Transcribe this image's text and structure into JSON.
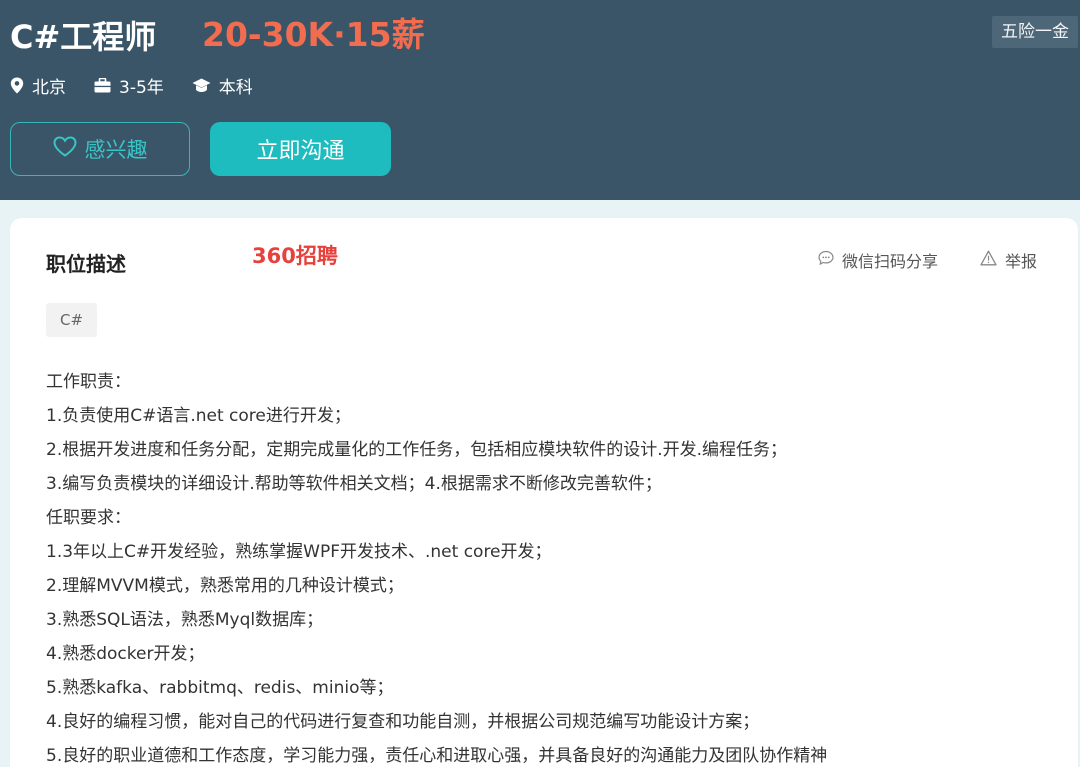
{
  "header": {
    "title": "C#工程师",
    "salary": "20-30K·15薪",
    "benefit": "五险一金",
    "meta": {
      "location": "北京",
      "experience": "3-5年",
      "education": "本科"
    },
    "follow_label": "感兴趣",
    "chat_label": "立即沟通"
  },
  "card": {
    "section_title": "职位描述",
    "watermark": "360招聘",
    "share_label": "微信扫码分享",
    "report_label": "举报",
    "skill_tags": [
      "C#"
    ],
    "description_lines": [
      "工作职责：",
      "1.负责使用C#语言.net core进行开发；",
      "2.根据开发进度和任务分配，定期完成量化的工作任务，包括相应模块软件的设计.开发.编程任务；",
      "3.编写负责模块的详细设计.帮助等软件相关文档；4.根据需求不断修改完善软件；",
      "任职要求：",
      "1.3年以上C#开发经验，熟练掌握WPF开发技术、.net core开发；",
      "2.理解MVVM模式，熟悉常用的几种设计模式；",
      "3.熟悉SQL语法，熟悉Myql数据库；",
      "4.熟悉docker开发；",
      "5.熟悉kafka、rabbitmq、redis、minio等；",
      "4.良好的编程习惯，能对自己的代码进行复查和功能自测，并根据公司规范编写功能设计方案；",
      "5.良好的职业道德和工作态度，学习能力强，责任心和进取心强，并具备良好的沟通能力及团队协作精神"
    ]
  },
  "colors": {
    "header_bg": "#3b5568",
    "salary": "#f26c4f",
    "accent": "#1ebcbf",
    "watermark": "#e8403a"
  },
  "icons": {
    "location": "location-pin-icon",
    "experience": "briefcase-icon",
    "education": "graduation-cap-icon",
    "follow": "heart-icon",
    "share": "chat-bubble-icon",
    "report": "warning-icon"
  }
}
